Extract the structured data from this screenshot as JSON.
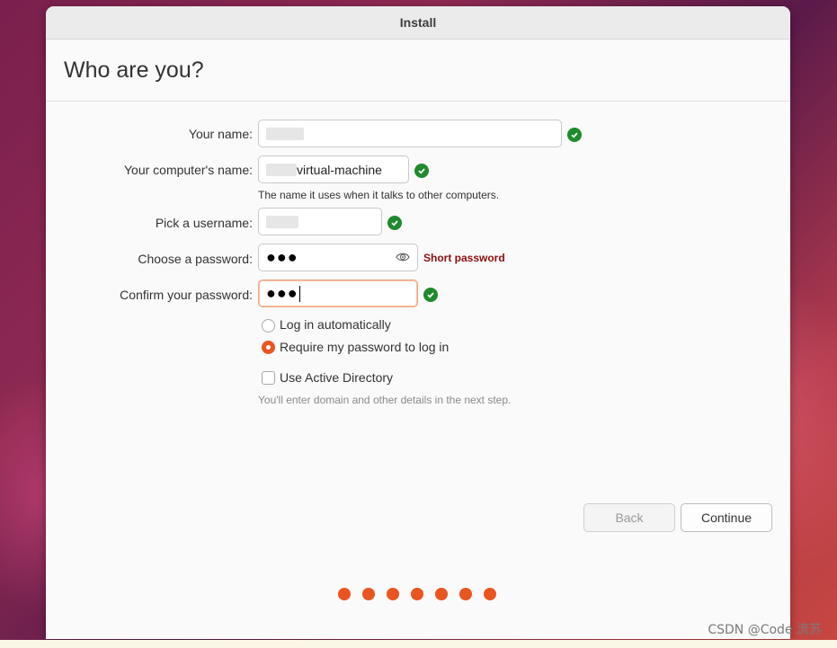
{
  "window": {
    "title": "Install"
  },
  "page": {
    "heading": "Who are you?"
  },
  "form": {
    "name": {
      "label": "Your name:",
      "value": ""
    },
    "computer": {
      "label": "Your computer's name:",
      "value_suffix": "virtual-machine",
      "hint": "The name it uses when it talks to other computers."
    },
    "username": {
      "label": "Pick a username:",
      "value": ""
    },
    "password": {
      "label": "Choose a password:",
      "value": "●●●",
      "warning": "Short password"
    },
    "confirm": {
      "label": "Confirm your password:",
      "value": "●●●"
    }
  },
  "login_options": {
    "auto": "Log in automatically",
    "require": "Require my password to log in",
    "selected": "require"
  },
  "active_directory": {
    "label": "Use Active Directory",
    "hint": "You'll enter domain and other details in the next step.",
    "checked": false
  },
  "buttons": {
    "back": "Back",
    "continue": "Continue"
  },
  "progress": {
    "steps": 7
  },
  "colors": {
    "accent": "#e95420",
    "success": "#1e8a2d",
    "warning": "#8a0f0f"
  },
  "watermark": "CSDN @Code 流苏"
}
